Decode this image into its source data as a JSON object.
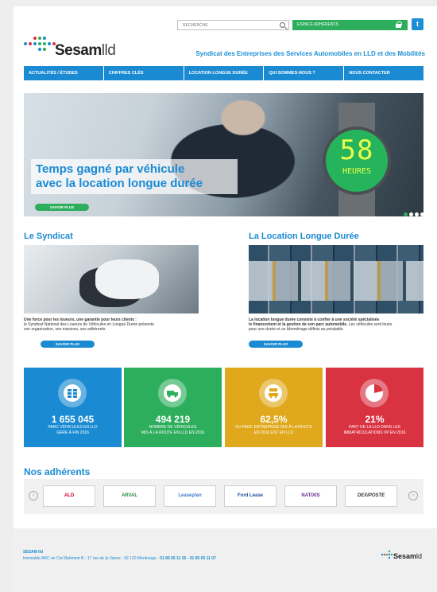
{
  "header": {
    "search_placeholder": "RECHERCHE",
    "member_space": "ESPACE ADHÉRENTS",
    "twitter": "t",
    "logo_bold": "Sesam",
    "logo_light": "lld",
    "tagline": "Syndicat des Entreprises des Services Automobiles en LLD et des Mobilités"
  },
  "nav": {
    "items": [
      "ACTUALITÉS / ÉTUDES",
      "CHIFFRES CLÉS",
      "LOCATION LONGUE DURÉE",
      "QUI SOMMES-NOUS ?",
      "NOUS CONTACTER"
    ]
  },
  "hero": {
    "headline_line1": "Temps gagné par véhicule",
    "headline_line2": "avec la location longue durée",
    "button": "SAVOIR PLUS",
    "watch_value": "58",
    "watch_unit": "HEURES",
    "slides": 4,
    "active_slide": 1
  },
  "syndicat": {
    "title": "Le Syndicat",
    "desc_bold": "Une force pour les loueurs, une garantie pour leurs clients :",
    "desc_line2": "le Syndicat National des Loueurs de Véhicules en Longue Durée présente",
    "desc_line3": "son organisation, ses missions, ses adhérents.",
    "button": "SAVOIR PLUS"
  },
  "lld": {
    "title": "La Location Longue Durée",
    "desc_bold1": "La location longue durée consiste à confier à une société spécialisée",
    "desc_bold2": "le financement et la gestion de son parc automobile.",
    "desc_rest2": " Les véhicules sont loués",
    "desc_line3": "pour une durée et un kilométrage définis au préalable.",
    "button": "SAVOIR PLUS"
  },
  "stats": [
    {
      "value": "1 655 045",
      "label1": "PARC VÉHICULES EN LLD",
      "label2": "GÉRÉ À FIN 2016",
      "color": "#1a8ad3",
      "icon": "cars-grid-icon"
    },
    {
      "value": "494 219",
      "label1": "NOMBRE DE VÉHICULES",
      "label2": "MIS À LA ROUTE EN LLD EN 2016",
      "color": "#2dae5d",
      "icon": "truck-icon"
    },
    {
      "value": "62,5%",
      "label1": "DU PARC ENTREPRISE MIS À LA ROUTE",
      "label2": "EN 2016 EST EN LLD",
      "color": "#e0a81c",
      "icon": "car-sign-icon"
    },
    {
      "value": "21%",
      "label1": "PART DE LA LLD DANS LES",
      "label2": "IMMATRICULATIONS VP EN 2016",
      "color": "#d93241",
      "icon": "pie-chart-icon",
      "pie_share": 0.21
    }
  ],
  "adherents": {
    "title": "Nos adhérents",
    "logos": [
      "ALD",
      "ARVAL",
      "Leaseplan",
      "Ford Lease",
      "NATIXIS",
      "DEXIPOSTE"
    ]
  },
  "footer": {
    "name": "SESAM lld",
    "address": "Immeuble ARC en Ciel Batiment B - 17 rue de la Vanne - 92 120 Montrouge - ",
    "phones": "01 85 65 11 25 - 01 85 65 11 07",
    "logo_bold": "Sesam",
    "logo_light": "ld"
  }
}
